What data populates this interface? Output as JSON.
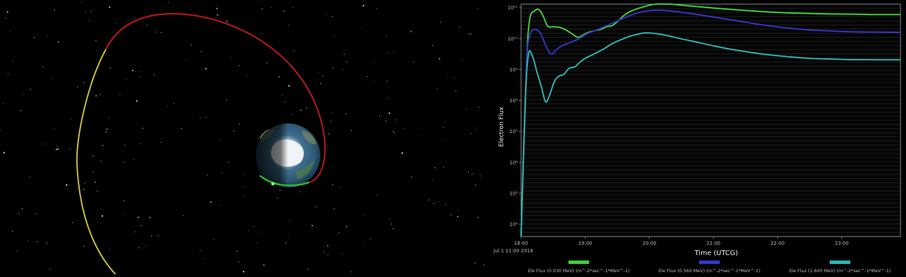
{
  "scene": {
    "orbit_colors": {
      "apogee_arc": "#b01818",
      "descending_arc": "#c9c23a",
      "perigee_arc": "#2fb52f"
    }
  },
  "chart_data": {
    "type": "line",
    "xlabel": "Time (UTCG)",
    "ylabel": "Electron Flux",
    "date_label": "Jul 1 11:00 2016",
    "x_ticks": [
      "18:00",
      "19:00",
      "20:00",
      "21:00",
      "22:00",
      "23:00"
    ],
    "xlim": [
      "18:00",
      "23:55"
    ],
    "y_scale": "log",
    "y_ticks": [
      {
        "value": 10000.0,
        "label": "10⁴"
      },
      {
        "value": 100000.0,
        "label": "10⁵"
      },
      {
        "value": 1000000.0,
        "label": "10⁶"
      },
      {
        "value": 10000000.0,
        "label": "10⁷"
      },
      {
        "value": 100000000.0,
        "label": "10⁸"
      },
      {
        "value": 1000000000.0,
        "label": "10⁹"
      },
      {
        "value": 10000000000.0,
        "label": "10¹⁰"
      },
      {
        "value": 100000000000.0,
        "label": "10¹¹"
      }
    ],
    "ylim": [
      4000,
      130000000000
    ],
    "grid": true,
    "legend_position": "bottom",
    "series": [
      {
        "name": "Ele Flux (0.030 MeV) (m^-2*sec^-1*MeV^-1)",
        "color": "#3fd03f",
        "x": [
          "18:00",
          "18:05",
          "18:08",
          "18:13",
          "18:17",
          "18:21",
          "18:25",
          "18:30",
          "18:36",
          "18:42",
          "18:48",
          "18:53",
          "18:58",
          "19:03",
          "19:09",
          "19:15",
          "19:20",
          "19:25",
          "19:30",
          "19:36",
          "19:42",
          "19:48",
          "19:54",
          "20:00",
          "20:06",
          "20:12",
          "20:20",
          "20:30",
          "20:45",
          "21:00",
          "21:15",
          "21:30",
          "21:45",
          "22:00",
          "22:15",
          "22:30",
          "22:45",
          "23:00",
          "23:15",
          "23:30",
          "23:55"
        ],
        "y": [
          4000,
          1000000000.0,
          40000000000.0,
          80000000000.0,
          85000000000.0,
          50000000000.0,
          25000000000.0,
          24000000000.0,
          23000000000.0,
          19000000000.0,
          14000000000.0,
          11000000000.0,
          13000000000.0,
          16000000000.0,
          18000000000.0,
          20000000000.0,
          24000000000.0,
          26000000000.0,
          35000000000.0,
          55000000000.0,
          75000000000.0,
          90000000000.0,
          105000000000.0,
          120000000000.0,
          130000000000.0,
          133000000000.0,
          130000000000.0,
          120000000000.0,
          108000000000.0,
          97000000000.0,
          88000000000.0,
          81000000000.0,
          75000000000.0,
          70000000000.0,
          67000000000.0,
          65000000000.0,
          63000000000.0,
          62000000000.0,
          61000000000.0,
          60000000000.0,
          60000000000.0
        ]
      },
      {
        "name": "Ele Flux (0.560 MeV) (m^-2*sec^-1*MeV^-1)",
        "color": "#3535c8",
        "x": [
          "18:00",
          "18:05",
          "18:08",
          "18:13",
          "18:18",
          "18:23",
          "18:28",
          "18:33",
          "18:38",
          "18:43",
          "18:48",
          "18:53",
          "18:58",
          "19:03",
          "19:09",
          "19:15",
          "19:20",
          "19:25",
          "19:30",
          "19:36",
          "19:42",
          "19:48",
          "19:54",
          "20:00",
          "20:06",
          "20:12",
          "20:20",
          "20:30",
          "20:45",
          "21:00",
          "21:15",
          "21:30",
          "21:45",
          "22:00",
          "22:15",
          "22:30",
          "22:45",
          "23:00",
          "23:15",
          "23:30",
          "23:55"
        ],
        "y": [
          4000,
          1000000000.0,
          12000000000.0,
          20000000000.0,
          15000000000.0,
          6000000000.0,
          3200000000.0,
          4300000000.0,
          5800000000.0,
          6800000000.0,
          8000000000.0,
          9500000000.0,
          12000000000.0,
          15000000000.0,
          18000000000.0,
          22000000000.0,
          26000000000.0,
          31000000000.0,
          37000000000.0,
          46000000000.0,
          56000000000.0,
          66000000000.0,
          74000000000.0,
          80000000000.0,
          83000000000.0,
          82000000000.0,
          78000000000.0,
          71000000000.0,
          60000000000.0,
          50000000000.0,
          41000000000.0,
          34000000000.0,
          28000000000.0,
          24000000000.0,
          21000000000.0,
          19000000000.0,
          18000000000.0,
          17000000000.0,
          16500000000.0,
          16200000000.0,
          16000000000.0
        ]
      },
      {
        "name": "Ele Flux (1.600 MeV) (m^-2*sec^-1*MeV^-1)",
        "color": "#2fb4b4",
        "x": [
          "18:00",
          "18:04",
          "18:07",
          "18:11",
          "18:15",
          "18:19",
          "18:23",
          "18:27",
          "18:31",
          "18:35",
          "18:40",
          "18:45",
          "18:50",
          "18:55",
          "19:00",
          "19:06",
          "19:12",
          "19:18",
          "19:24",
          "19:30",
          "19:36",
          "19:42",
          "19:48",
          "19:54",
          "20:00",
          "20:06",
          "20:12",
          "20:20",
          "20:30",
          "20:45",
          "21:00",
          "21:15",
          "21:30",
          "21:45",
          "22:00",
          "22:15",
          "22:30",
          "22:45",
          "23:00",
          "23:15",
          "23:55"
        ],
        "y": [
          4000,
          100000000.0,
          3200000000.0,
          2500000000.0,
          800000000.0,
          280000000.0,
          90000000.0,
          160000000.0,
          400000000.0,
          600000000.0,
          700000000.0,
          1100000000.0,
          1200000000.0,
          1700000000.0,
          2300000000.0,
          2900000000.0,
          3700000000.0,
          4800000000.0,
          6500000000.0,
          8200000000.0,
          10000000000.0,
          12000000000.0,
          13500000000.0,
          15000000000.0,
          15200000000.0,
          14500000000.0,
          13500000000.0,
          11800000000.0,
          9800000000.0,
          7600000000.0,
          5800000000.0,
          4600000000.0,
          3800000000.0,
          3200000000.0,
          2800000000.0,
          2500000000.0,
          2300000000.0,
          2200000000.0,
          2120000000.0,
          2080000000.0,
          2050000000.0
        ]
      }
    ]
  }
}
